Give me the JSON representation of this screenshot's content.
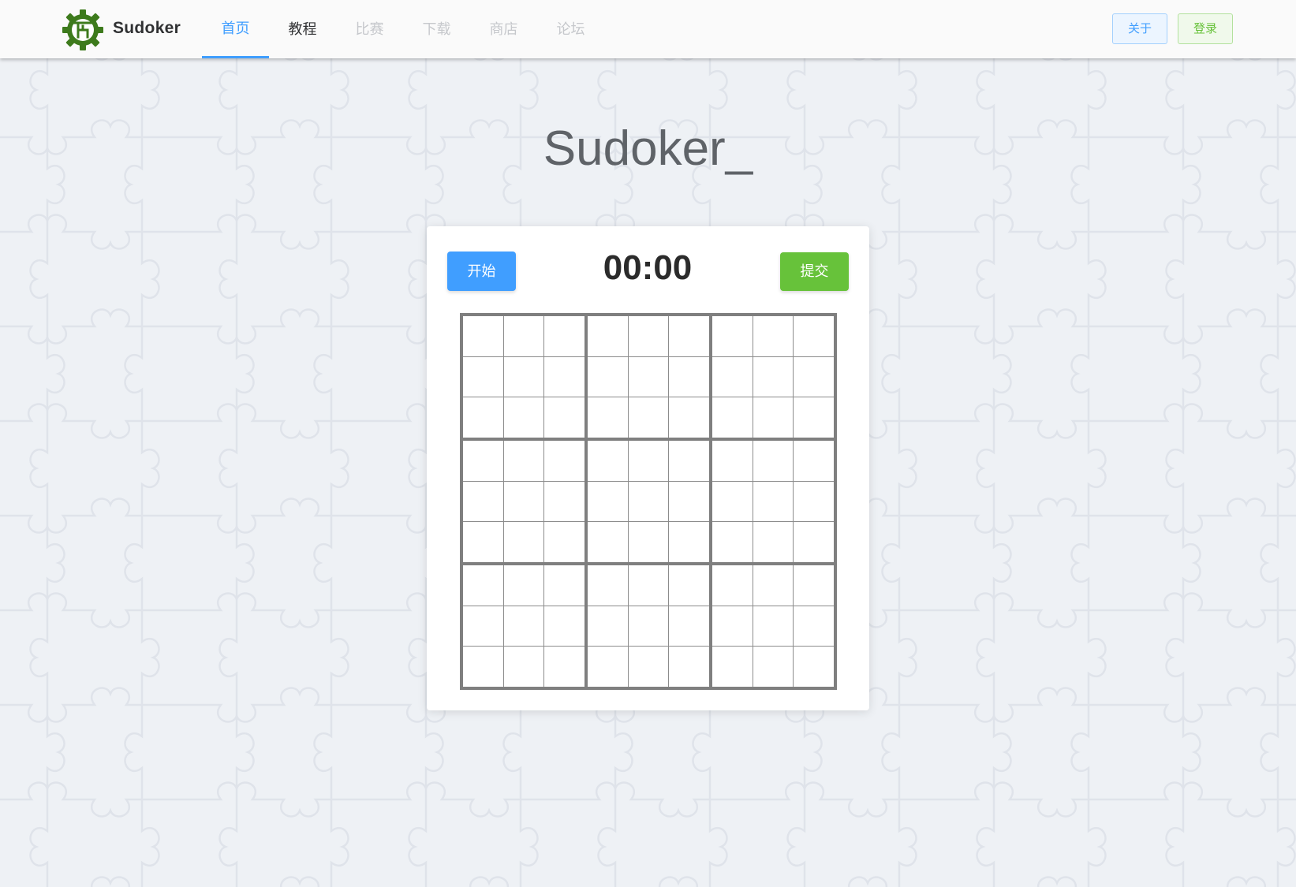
{
  "header": {
    "brand": "Sudoker",
    "nav": [
      {
        "label": "首页",
        "state": "active"
      },
      {
        "label": "教程",
        "state": "normal"
      },
      {
        "label": "比赛",
        "state": "disabled"
      },
      {
        "label": "下载",
        "state": "disabled"
      },
      {
        "label": "商店",
        "state": "disabled"
      },
      {
        "label": "论坛",
        "state": "disabled"
      }
    ],
    "about_label": "关于",
    "login_label": "登录"
  },
  "main": {
    "title": "Sudoker_",
    "start_label": "开始",
    "timer": "00:00",
    "submit_label": "提交",
    "grid_size": 9,
    "cell_values": []
  },
  "colors": {
    "primary": "#409eff",
    "success": "#67c23a",
    "background": "#eef1f5",
    "logo": "#3d7a1c"
  },
  "icons": {
    "logo": "gear-logo-icon"
  }
}
